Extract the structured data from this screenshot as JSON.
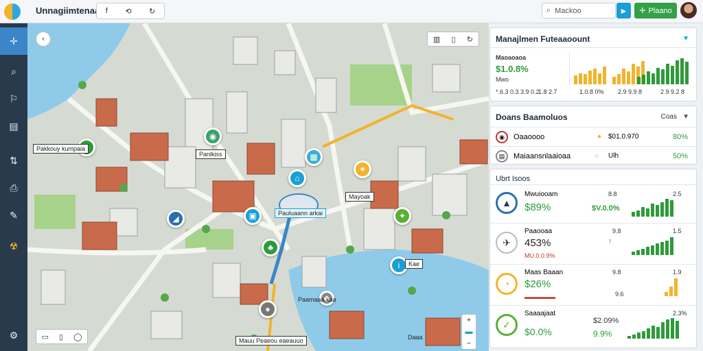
{
  "app": {
    "title": "Unnagiimtenaar"
  },
  "toolbar": {
    "icon1": "f",
    "icon2": "⟲",
    "icon3": "↻"
  },
  "search": {
    "placeholder": "Mackoo",
    "button_icon": "►"
  },
  "action": {
    "label": "Plaano"
  },
  "sidebar": {
    "items": [
      "✛",
      "⌕",
      "⚐",
      "▤",
      "⇅",
      "⎙",
      "✎",
      "☢",
      "⚙"
    ]
  },
  "map": {
    "labels": {
      "a": "Pakkouy kumpaia",
      "b": "Panlkiss",
      "c": "Pauluaann arkai",
      "d": "Mayoak",
      "e": "Kae",
      "f": "Mauu Peaeou eaeauuo",
      "g": "Paamaaa kaa",
      "h": "Daaa"
    },
    "controls": {
      "back": "‹",
      "top": [
        "▥",
        "▯",
        "↻"
      ],
      "bottom": [
        "▭",
        "▯",
        "◯"
      ],
      "zoom": [
        "+",
        "▬",
        "−"
      ]
    }
  },
  "overview": {
    "title": "Manajlmen Futeaaoount",
    "subtitle": "Maoaoaoa",
    "metric1": {
      "value": "$1.0.8%",
      "sub": "Mwo",
      "label1": "*.6.3 0.3 3.9 0.2",
      "label2": "1.8 2.7"
    },
    "metric2": {
      "label1": "1.0.8 0%",
      "label2": "1.8 8.9 6"
    },
    "metric3": {
      "label1": "2.9 9.9 8",
      "label2": "2.9 9.2 8"
    },
    "bars": [
      [
        8,
        10,
        9,
        12,
        14,
        10,
        16
      ],
      [
        6,
        8,
        12,
        10,
        16,
        14,
        18
      ],
      [
        8,
        10,
        14,
        12,
        18,
        16,
        22,
        20,
        26,
        28,
        24
      ]
    ]
  },
  "routes": {
    "title": "Doans Baamoluos",
    "filter": "Coas",
    "rows": [
      {
        "name": "Oaaoooo",
        "value": "$01.0.970",
        "percent": "80%"
      },
      {
        "name": "Maiaansnlaaioaa",
        "value": "Ulh",
        "percent": "50%"
      }
    ]
  },
  "fleet": {
    "title": "Ubrt Isoos",
    "items": [
      {
        "name": "Mwuiooam",
        "value": "$89%",
        "top": "8.8",
        "top2": "2.5",
        "mid": "$V.0.0%",
        "bars": [
          6,
          8,
          12,
          10,
          16,
          14,
          18,
          22,
          20
        ]
      },
      {
        "name": "Paaooaa",
        "value": "453%",
        "top": "9.8",
        "top2": "1.5",
        "mid": "MU.0.0.9%",
        "bars": [
          4,
          6,
          8,
          10,
          12,
          14,
          16,
          18,
          22
        ]
      },
      {
        "name": "Maas Baaan",
        "value": "$26%",
        "top": "9.8",
        "top2": "1.9",
        "mid": "9.6",
        "bars": [
          4,
          10,
          18
        ]
      },
      {
        "name": "Saaaajaat",
        "value": "$0.0%",
        "top": "$2.09%",
        "top2": "2.3%",
        "mid": "9.9%",
        "bars": [
          4,
          6,
          8,
          10,
          14,
          18,
          16,
          22,
          26,
          28,
          24
        ]
      }
    ]
  },
  "colors": {
    "sidebar": "#2a3a4d",
    "accent": "#1aa0d4",
    "green": "#2e9b3a",
    "water": "#7ec3e6"
  }
}
